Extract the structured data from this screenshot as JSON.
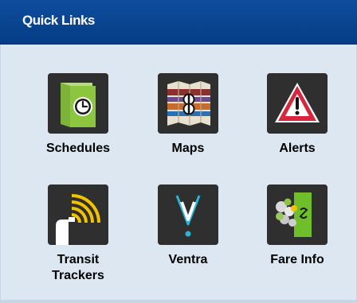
{
  "header": {
    "title": "Quick Links"
  },
  "links": [
    {
      "label": "Schedules",
      "icon": "schedule-clock-icon"
    },
    {
      "label": "Maps",
      "icon": "map-icon"
    },
    {
      "label": "Alerts",
      "icon": "alert-triangle-icon"
    },
    {
      "label": "Transit\nTrackers",
      "icon": "transit-tracker-icon"
    },
    {
      "label": "Ventra",
      "icon": "ventra-icon"
    },
    {
      "label": "Fare Info",
      "icon": "fare-info-icon"
    }
  ],
  "colors": {
    "header_bg": "#0a468f",
    "body_bg": "#dce7f2",
    "icon_tile_bg": "#2f2f2f",
    "schedule_green": "#8cc63f",
    "alert_red": "#d7263d",
    "tracker_yellow": "#f2c200",
    "ventra_cyan": "#2ab5d6"
  }
}
